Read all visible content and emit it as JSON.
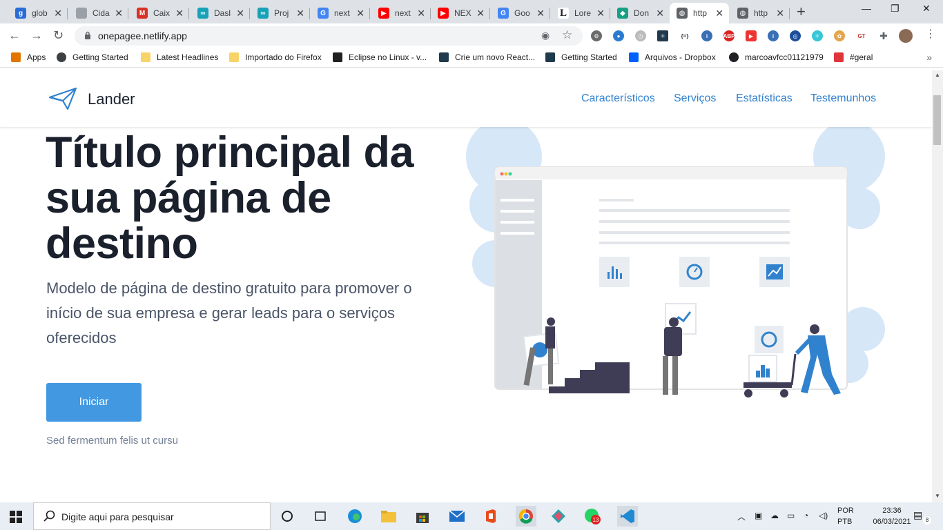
{
  "browser": {
    "tabs": [
      {
        "label": "glob",
        "icon": "g1-icon",
        "color": "#2a6cd6",
        "glyph": "g"
      },
      {
        "label": "Cida",
        "icon": "document-icon",
        "color": "#9aa0a6",
        "glyph": ""
      },
      {
        "label": "Caix",
        "icon": "gmail-icon",
        "color": "#d93025",
        "glyph": "M"
      },
      {
        "label": "Dasl",
        "icon": "infinity-icon",
        "color": "#17a2b8",
        "glyph": "∞"
      },
      {
        "label": "Proj",
        "icon": "infinity-icon",
        "color": "#17a2b8",
        "glyph": "∞"
      },
      {
        "label": "next",
        "icon": "google-icon",
        "color": "#4285f4",
        "glyph": "G"
      },
      {
        "label": "next",
        "icon": "youtube-icon",
        "color": "#ff0000",
        "glyph": "▶"
      },
      {
        "label": "NEX",
        "icon": "youtube-icon",
        "color": "#ff0000",
        "glyph": "▶"
      },
      {
        "label": "Goo",
        "icon": "translate-icon",
        "color": "#4285f4",
        "glyph": "G"
      },
      {
        "label": "Lore",
        "icon": "lorem-icon",
        "color": "#ffffff",
        "glyph": "L"
      },
      {
        "label": "Don",
        "icon": "diamond-icon",
        "color": "#16a085",
        "glyph": "◆"
      },
      {
        "label": "http",
        "icon": "globe-icon",
        "color": "#5f6368",
        "glyph": "◍"
      },
      {
        "label": "http",
        "icon": "globe-icon",
        "color": "#5f6368",
        "glyph": "◍"
      }
    ],
    "active_tab": 11,
    "url": "onepagee.netlify.app",
    "bookmarks": [
      {
        "label": "Apps",
        "icon": "apps-grid-icon"
      },
      {
        "label": "Getting Started",
        "icon": "firefox-icon"
      },
      {
        "label": "Latest Headlines",
        "icon": "folder-icon"
      },
      {
        "label": "Importado do Firefox",
        "icon": "folder-icon"
      },
      {
        "label": "Eclipse no Linux - v...",
        "icon": "linux-icon"
      },
      {
        "label": "Crie um novo React...",
        "icon": "react-icon"
      },
      {
        "label": "Getting Started",
        "icon": "react-icon"
      },
      {
        "label": "Arquivos - Dropbox",
        "icon": "dropbox-icon"
      },
      {
        "label": "marcoavfcc01121979",
        "icon": "github-icon"
      },
      {
        "label": "#geral",
        "icon": "rocketchat-icon"
      }
    ]
  },
  "site": {
    "brand": "Lander",
    "nav": [
      "Característicos",
      "Serviços",
      "Estatísticas",
      "Testemunhos"
    ],
    "hero_title": "Título principal da sua página de destino",
    "hero_subtitle": "Modelo de página de destino gratuito para promover o início de sua empresa e gerar leads para o serviços oferecidos",
    "cta_label": "Iniciar",
    "small_note": "Sed fermentum felis ut cursu",
    "accent_color": "#4299e1"
  },
  "taskbar": {
    "search_placeholder": "Digite aqui para pesquisar",
    "whatsapp_badge": "13",
    "lang_line1": "POR",
    "lang_line2": "PTB",
    "time": "23:36",
    "date": "06/03/2021",
    "notifications": "8"
  }
}
